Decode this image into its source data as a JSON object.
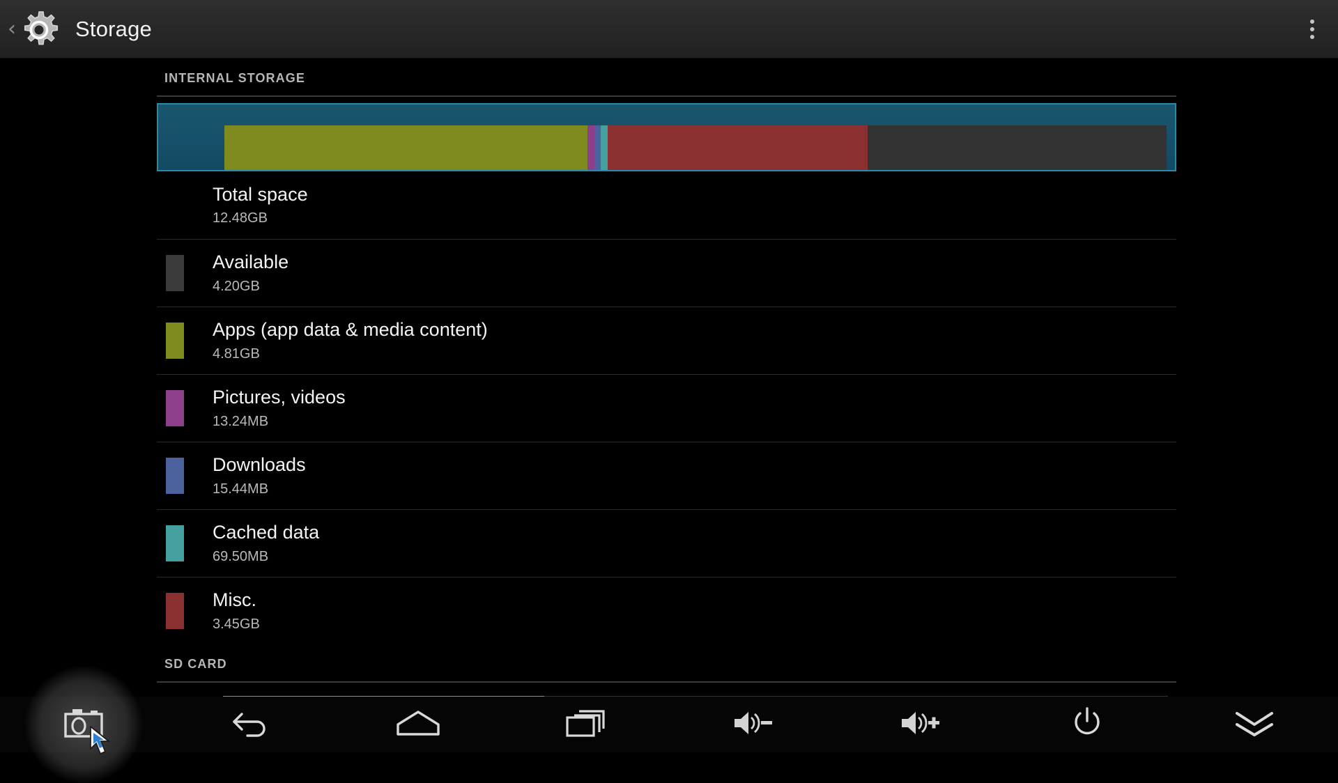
{
  "window": {
    "title": "Storage",
    "back_label": "‹",
    "app_icon": "settings-gear-icon",
    "overflow_label": "More options"
  },
  "colors": {
    "available": "#3b3b3b",
    "apps": "#7f8b1e",
    "pictures": "#8e3f8c",
    "downloads": "#4c629f",
    "cached": "#45a0a0",
    "misc": "#8a3030",
    "free_track": "#333333",
    "meter_fill": "#17506a",
    "meter_border": "#2a8aa8",
    "sd_used": "#8f8f8f"
  },
  "internal_storage": {
    "section_label": "INTERNAL STORAGE",
    "meter": {
      "segments": [
        {
          "name": "apps",
          "label": "Apps (app data & media content)",
          "percent": 38.55,
          "color": "#7f8b1e"
        },
        {
          "name": "pictures",
          "label": "Pictures, videos",
          "percent": 0.7,
          "color": "#8e3f8c"
        },
        {
          "name": "downloads",
          "label": "Downloads",
          "percent": 0.7,
          "color": "#4c629f"
        },
        {
          "name": "cached",
          "label": "Cached data",
          "percent": 0.7,
          "color": "#45a0a0"
        },
        {
          "name": "misc",
          "label": "Misc.",
          "percent": 27.65,
          "color": "#8a3030"
        },
        {
          "name": "available",
          "label": "Available",
          "percent": 31.7,
          "color": "#333333"
        }
      ]
    },
    "rows": [
      {
        "name": "total-space",
        "title": "Total space",
        "value": "12.48GB",
        "color": null
      },
      {
        "name": "available",
        "title": "Available",
        "value": "4.20GB",
        "color": "#3b3b3b"
      },
      {
        "name": "apps",
        "title": "Apps (app data & media content)",
        "value": "4.81GB",
        "color": "#7f8b1e"
      },
      {
        "name": "pictures",
        "title": "Pictures, videos",
        "value": "13.24MB",
        "color": "#8e3f8c"
      },
      {
        "name": "downloads",
        "title": "Downloads",
        "value": "15.44MB",
        "color": "#4c629f"
      },
      {
        "name": "cached",
        "title": "Cached data",
        "value": "69.50MB",
        "color": "#45a0a0"
      },
      {
        "name": "misc",
        "title": "Misc.",
        "value": "3.45GB",
        "color": "#8a3030"
      }
    ]
  },
  "sd_card": {
    "section_label": "SD CARD",
    "meter": {
      "segments": [
        {
          "name": "sd-used",
          "percent": 34.0,
          "color": "#8f8f8f"
        },
        {
          "name": "sd-free",
          "percent": 66.0,
          "color": "#333333"
        }
      ]
    }
  },
  "nav_bar": {
    "buttons": [
      {
        "name": "screenshot",
        "icon": "camera-icon",
        "label": "Screenshot"
      },
      {
        "name": "back",
        "icon": "back-arrow-icon",
        "label": "Back"
      },
      {
        "name": "home",
        "icon": "home-icon",
        "label": "Home"
      },
      {
        "name": "recents",
        "icon": "recent-apps-icon",
        "label": "Recent apps"
      },
      {
        "name": "vol-down",
        "icon": "volume-down-icon",
        "label": "Volume down"
      },
      {
        "name": "vol-up",
        "icon": "volume-up-icon",
        "label": "Volume up"
      },
      {
        "name": "power",
        "icon": "power-icon",
        "label": "Power"
      },
      {
        "name": "collapse",
        "icon": "chevron-double-down-icon",
        "label": "Hide bar"
      }
    ]
  }
}
